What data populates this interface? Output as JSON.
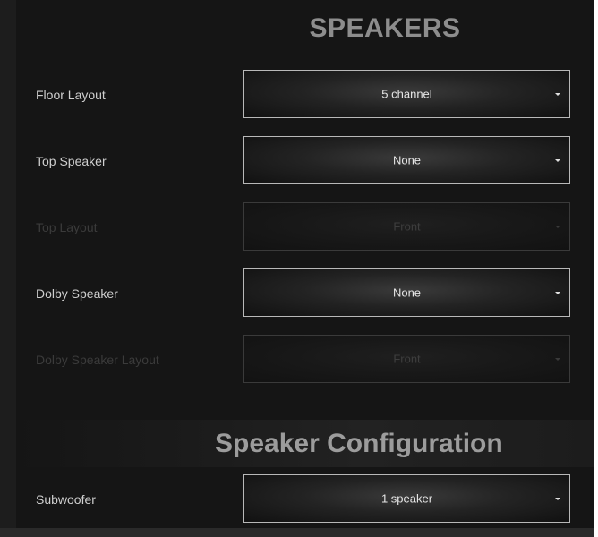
{
  "header": {
    "title": "SPEAKERS"
  },
  "rows": [
    {
      "label": "Floor Layout",
      "value": "5 channel",
      "enabled": true
    },
    {
      "label": "Top Speaker",
      "value": "None",
      "enabled": true
    },
    {
      "label": "Top Layout",
      "value": "Front",
      "enabled": false
    },
    {
      "label": "Dolby Speaker",
      "value": "None",
      "enabled": true
    },
    {
      "label": "Dolby Speaker Layout",
      "value": "Front",
      "enabled": false
    }
  ],
  "section": {
    "title": "Speaker Configuration"
  },
  "config_rows": [
    {
      "label": "Subwoofer",
      "value": "1 speaker",
      "enabled": true
    }
  ],
  "icons": {
    "dropdown": "caret-down-icon"
  },
  "colors": {
    "background": "#151515",
    "text": "#cfcfcf",
    "disabled_text": "#3b3b3b",
    "border": "#b8b8b8"
  }
}
